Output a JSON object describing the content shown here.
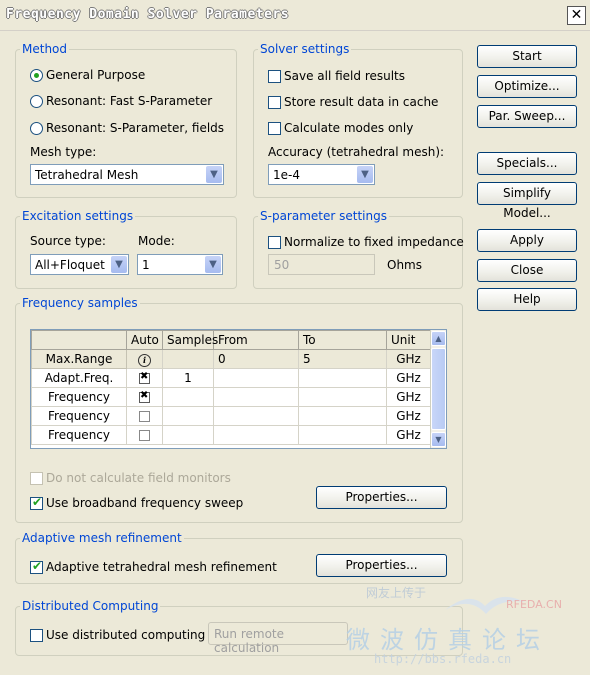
{
  "window": {
    "title": "Frequency Domain Solver Parameters",
    "close_glyph": "✕"
  },
  "method": {
    "label": "Method",
    "options": [
      "General Purpose",
      "Resonant: Fast S-Parameter",
      "Resonant: S-Parameter, fields"
    ],
    "selected_index": 0,
    "mesh_type_label": "Mesh type:",
    "mesh_type_value": "Tetrahedral Mesh"
  },
  "solver": {
    "label": "Solver settings",
    "checks": [
      {
        "label": "Save all field results",
        "checked": false
      },
      {
        "label": "Store result data in cache",
        "checked": false
      },
      {
        "label": "Calculate modes only",
        "checked": false
      }
    ],
    "accuracy_label": "Accuracy (tetrahedral mesh):",
    "accuracy_value": "1e-4"
  },
  "buttons": {
    "start": "Start",
    "optimize": "Optimize...",
    "par_sweep": "Par. Sweep...",
    "specials": "Specials...",
    "simplify": "Simplify Model...",
    "apply": "Apply",
    "close": "Close",
    "help": "Help"
  },
  "excitation": {
    "label": "Excitation settings",
    "source_type_label": "Source type:",
    "source_type_value": "All+Floquet",
    "mode_label": "Mode:",
    "mode_value": "1"
  },
  "sparam": {
    "label": "S-parameter settings",
    "normalize_label": "Normalize to fixed impedance",
    "normalize_checked": false,
    "impedance_value": "50",
    "impedance_unit": "Ohms"
  },
  "freq_samples": {
    "label": "Frequency samples",
    "columns": [
      "",
      "Auto",
      "Samples",
      "From",
      "To",
      "Unit"
    ],
    "rows": [
      {
        "type": "Max.Range",
        "auto": "info",
        "samples": "",
        "from": "0",
        "to": "5",
        "unit": "GHz"
      },
      {
        "type": "Adapt.Freq.",
        "auto": "checked",
        "samples": "1",
        "from": "",
        "to": "",
        "unit": "GHz"
      },
      {
        "type": "Frequency",
        "auto": "checked",
        "samples": "",
        "from": "",
        "to": "",
        "unit": "GHz"
      },
      {
        "type": "Frequency",
        "auto": "unchecked",
        "samples": "",
        "from": "",
        "to": "",
        "unit": "GHz"
      },
      {
        "type": "Frequency",
        "auto": "unchecked",
        "samples": "",
        "from": "",
        "to": "",
        "unit": "GHz"
      }
    ],
    "no_field_monitors_label": "Do not calculate field monitors",
    "no_field_monitors_checked": false,
    "broadband_label": "Use broadband frequency sweep",
    "broadband_checked": true,
    "properties_label": "Properties..."
  },
  "adaptive": {
    "label": "Adaptive mesh refinement",
    "check_label": "Adaptive tetrahedral mesh refinement",
    "checked": true,
    "properties_label": "Properties..."
  },
  "distributed": {
    "label": "Distributed Computing",
    "check_label": "Use distributed computing",
    "checked": false,
    "remote_label": "Run remote calculation"
  },
  "watermark": {
    "line1": "网友上传于",
    "brand": "RFEDA.CN",
    "cn_title": "微波仿真论坛",
    "url": "http://bbs.rfeda.cn"
  }
}
